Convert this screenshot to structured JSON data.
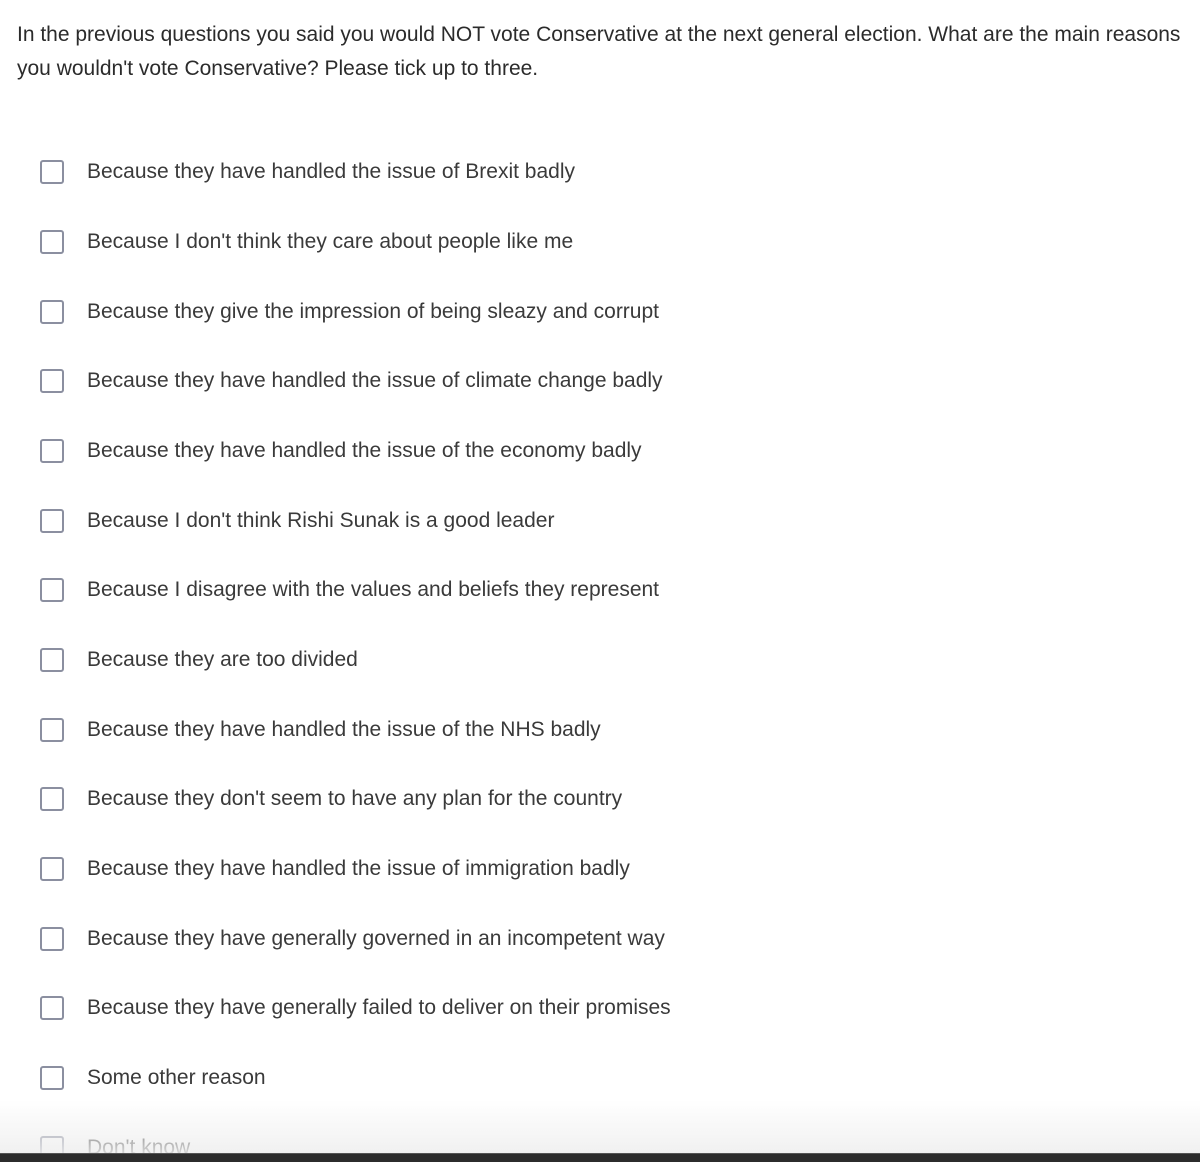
{
  "question": {
    "text": "In the previous questions you said you would NOT vote Conservative at the next general election. What are the main reasons you wouldn't vote Conservative? Please tick up to three."
  },
  "options": [
    {
      "label": "Because they have handled the issue of Brexit badly",
      "checked": false
    },
    {
      "label": "Because I don't think they care about people like me",
      "checked": false
    },
    {
      "label": "Because they give the impression of being sleazy and corrupt",
      "checked": false
    },
    {
      "label": "Because they have handled the issue of climate change badly",
      "checked": false
    },
    {
      "label": "Because they have handled the issue of the economy badly",
      "checked": false
    },
    {
      "label": "Because I don't think Rishi Sunak is a good leader",
      "checked": false
    },
    {
      "label": "Because I disagree with the values and beliefs they represent",
      "checked": false
    },
    {
      "label": "Because they are too divided",
      "checked": false
    },
    {
      "label": "Because they have handled the issue of the NHS badly",
      "checked": false
    },
    {
      "label": "Because they don't seem to have any plan for the country",
      "checked": false
    },
    {
      "label": "Because they have handled the issue of immigration badly",
      "checked": false
    },
    {
      "label": "Because they have generally governed in an incompetent way",
      "checked": false
    },
    {
      "label": "Because they have generally failed to deliver on their promises",
      "checked": false
    },
    {
      "label": "Some other reason",
      "checked": false
    },
    {
      "label": "Don't know",
      "checked": false
    }
  ]
}
